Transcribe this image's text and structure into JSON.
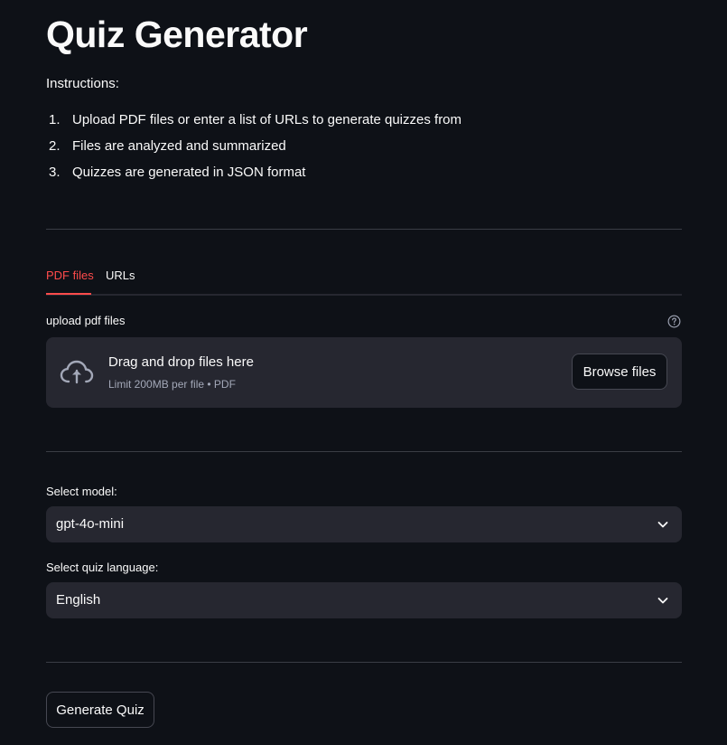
{
  "page": {
    "title": "Quiz Generator",
    "instructions_label": "Instructions:",
    "steps": [
      {
        "num": "1.",
        "text": "Upload PDF files or enter a list of URLs to generate quizzes from"
      },
      {
        "num": "2.",
        "text": "Files are analyzed and summarized"
      },
      {
        "num": "3.",
        "text": "Quizzes are generated in JSON format"
      }
    ]
  },
  "tabs": [
    {
      "label": "PDF files",
      "active": true
    },
    {
      "label": "URLs",
      "active": false
    }
  ],
  "uploader": {
    "label": "upload pdf files",
    "help_icon": "question-circle-icon",
    "drop_title": "Drag and drop files here",
    "drop_subtitle": "Limit 200MB per file • PDF",
    "upload_icon": "cloud-upload-icon",
    "browse_label": "Browse files"
  },
  "model_select": {
    "label": "Select model:",
    "value": "gpt-4o-mini",
    "icon": "chevron-down-icon"
  },
  "language_select": {
    "label": "Select quiz language:",
    "value": "English",
    "icon": "chevron-down-icon"
  },
  "actions": {
    "generate_label": "Generate Quiz"
  },
  "colors": {
    "background": "#0e1117",
    "surface": "#262730",
    "accent": "#ff4b4b",
    "text": "#fafafa",
    "muted_text": "#a3a8b8"
  }
}
